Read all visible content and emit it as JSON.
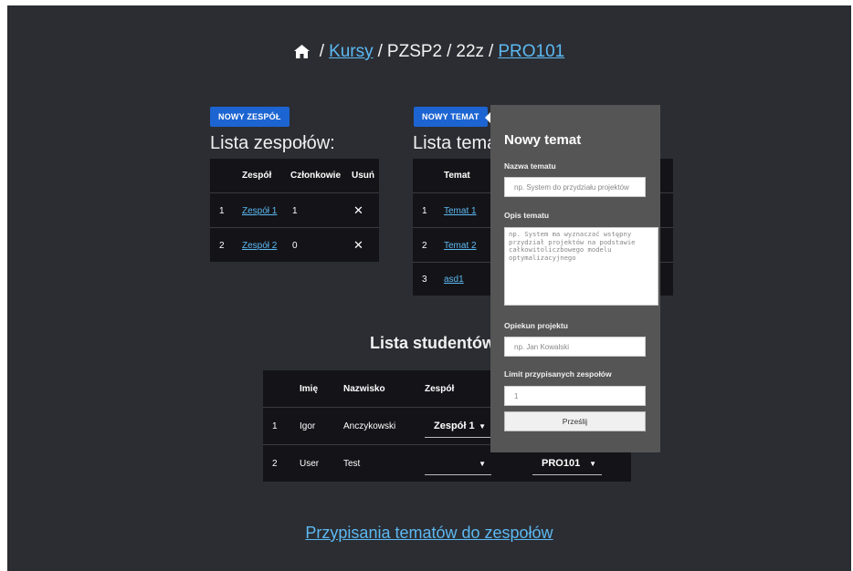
{
  "breadcrumb": {
    "kursy": "Kursy",
    "pzsp2": "PZSP2",
    "term": "22z",
    "course": "PRO101",
    "separator": "/"
  },
  "teams": {
    "new_button": "NOWY ZESPÓŁ",
    "title": "Lista zespołów:",
    "headers": {
      "team": "Zespół",
      "members": "Członkowie",
      "remove": "Usuń"
    },
    "rows": [
      {
        "num": "1",
        "name": "Zespół 1",
        "members": "1",
        "remove": "✕"
      },
      {
        "num": "2",
        "name": "Zespół 2",
        "members": "0",
        "remove": "✕"
      }
    ]
  },
  "topics": {
    "new_button": "NOWY TEMAT",
    "title": "Lista tema",
    "headers": {
      "topic": "Temat"
    },
    "rows": [
      {
        "num": "1",
        "name": "Temat 1"
      },
      {
        "num": "2",
        "name": "Temat 2"
      },
      {
        "num": "3",
        "name": "asd1"
      }
    ]
  },
  "students": {
    "title": "Lista studentów",
    "headers": {
      "first": "Imię",
      "last": "Nazwisko",
      "team": "Zespół"
    },
    "rows": [
      {
        "num": "1",
        "first": "Igor",
        "last": "Anczykowski",
        "team": "Zespół 1",
        "topic": ""
      },
      {
        "num": "2",
        "first": "User",
        "last": "Test",
        "team": "",
        "topic": "PRO101"
      }
    ]
  },
  "popup": {
    "title": "Nowy temat",
    "name_label": "Nazwa tematu",
    "name_placeholder": "np. System do przydziału projektów",
    "desc_label": "Opis tematu",
    "desc_placeholder": "np. System ma wyznaczać wstępny przydział projektów na podstawie całkowitoliczbowego modelu optymalizacyjnego",
    "supervisor_label": "Opiekun projektu",
    "supervisor_placeholder": "np. Jan Kowalski",
    "limit_label": "Limit przypisanych zespołów",
    "limit_placeholder": "1",
    "submit": "Prześlij"
  },
  "bottom_link": "Przypisania tematów do zespołów",
  "colors": {
    "background": "#2b2d33",
    "table": "#141418",
    "accent_button": "#1c64d1",
    "link": "#5cb9f2",
    "popup": "#555555"
  },
  "icons": {
    "home": "home-icon",
    "remove": "close-icon",
    "dropdown": "caret-down-icon"
  }
}
